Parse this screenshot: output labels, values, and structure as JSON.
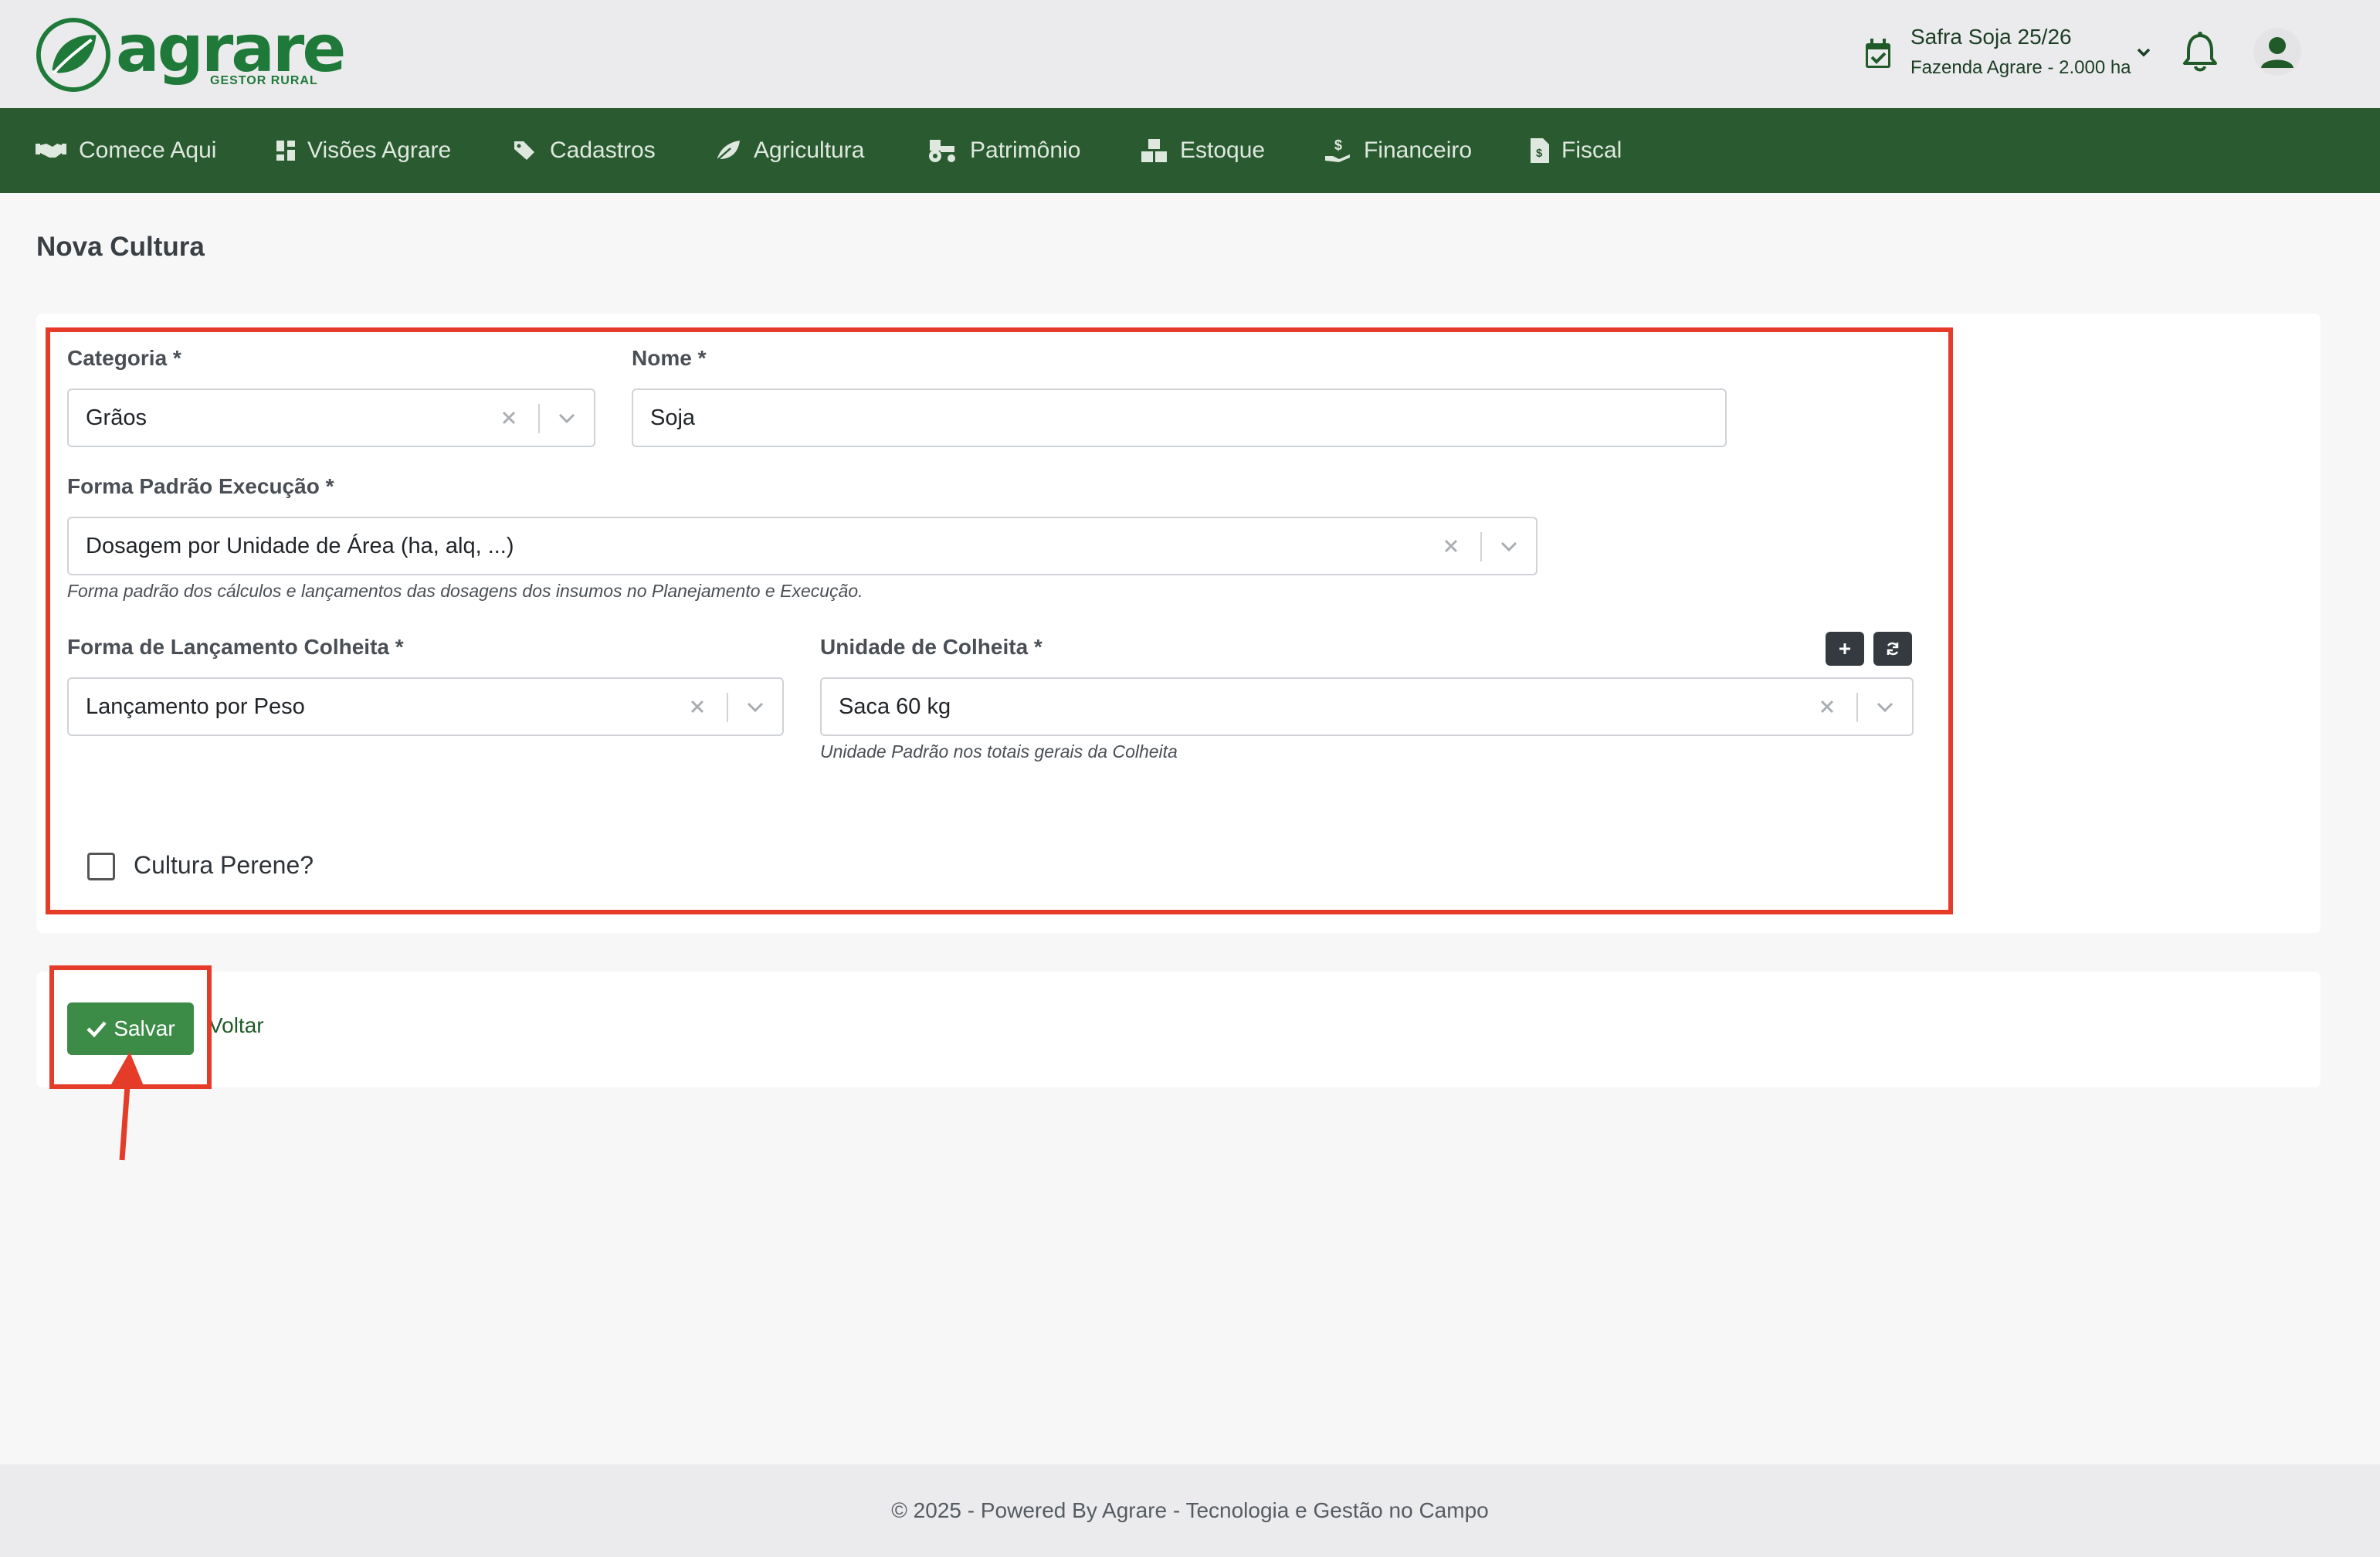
{
  "brand": {
    "name": "agrare",
    "tagline": "GESTOR RURAL",
    "color": "#1f7a3a"
  },
  "header": {
    "safra_title": "Safra Soja 25/26",
    "safra_subtitle": "Fazenda Agrare - 2.000 ha",
    "icons": [
      "calendar-check-icon",
      "chevron-down-icon",
      "bell-icon",
      "user-icon"
    ]
  },
  "nav": {
    "items": [
      {
        "label": "Comece Aqui",
        "icon": "handshake-icon"
      },
      {
        "label": "Visões Agrare",
        "icon": "dashboard-icon"
      },
      {
        "label": "Cadastros",
        "icon": "tags-icon"
      },
      {
        "label": "Agricultura",
        "icon": "leaf-icon"
      },
      {
        "label": "Patrimônio",
        "icon": "tractor-icon"
      },
      {
        "label": "Estoque",
        "icon": "boxes-icon"
      },
      {
        "label": "Financeiro",
        "icon": "hand-dollar-icon"
      },
      {
        "label": "Fiscal",
        "icon": "file-invoice-icon"
      }
    ],
    "background": "#2a5a30"
  },
  "page": {
    "title": "Nova Cultura"
  },
  "form": {
    "categoria": {
      "label": "Categoria *",
      "value": "Grãos"
    },
    "nome": {
      "label": "Nome *",
      "value": "Soja"
    },
    "forma_padrao": {
      "label": "Forma Padrão Execução *",
      "value": "Dosagem por Unidade de Área (ha, alq, ...)",
      "hint": "Forma padrão dos cálculos e lançamentos das dosagens dos insumos no Planejamento e Execução."
    },
    "forma_lancamento": {
      "label": "Forma de Lançamento Colheita *",
      "value": "Lançamento por Peso"
    },
    "unidade_colheita": {
      "label": "Unidade de Colheita *",
      "value": "Saca 60 kg",
      "hint": "Unidade Padrão nos totais gerais da Colheita",
      "add_icon": "plus-icon",
      "refresh_icon": "refresh-icon"
    },
    "perene": {
      "label": "Cultura Perene?",
      "checked": false
    }
  },
  "actions": {
    "save_label": "Salvar",
    "back_label": "Voltar",
    "save_color": "#3c8c48"
  },
  "footer": {
    "text": "© 2025 - Powered By Agrare - Tecnologia e Gestão no Campo"
  },
  "annotation_color": "#e53c2a"
}
